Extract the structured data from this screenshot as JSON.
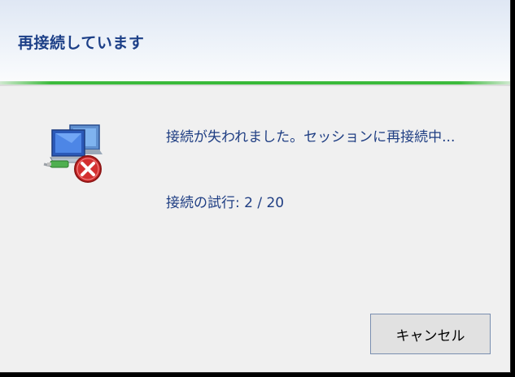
{
  "dialog": {
    "title": "再接続しています",
    "message": "接続が失われました。セッションに再接続中...",
    "attempt_label": "接続の試行:",
    "attempt_value": "2 / 20",
    "cancel_label": "キャンセル",
    "icon": "network-disconnected-icon",
    "colors": {
      "title": "#1c3f87",
      "text": "#1f3e83",
      "progress_accent": "#38b938",
      "error": "#d32f2f"
    }
  }
}
